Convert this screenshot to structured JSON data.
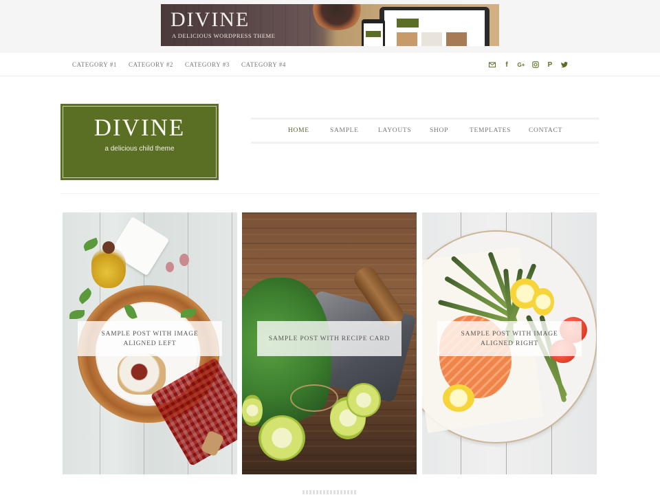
{
  "banner": {
    "title": "DIVINE",
    "tagline": "A DELICIOUS WORDPRESS THEME",
    "preview_logo": "DIVINE"
  },
  "top_nav": {
    "categories": [
      {
        "label": "CATEGORY #1"
      },
      {
        "label": "CATEGORY #2"
      },
      {
        "label": "CATEGORY #3"
      },
      {
        "label": "CATEGORY #4"
      }
    ],
    "social": [
      {
        "name": "email-icon"
      },
      {
        "name": "facebook-icon",
        "glyph": "f"
      },
      {
        "name": "google-plus-icon",
        "glyph": "G+"
      },
      {
        "name": "instagram-icon"
      },
      {
        "name": "pinterest-icon",
        "glyph": "P"
      },
      {
        "name": "twitter-icon"
      }
    ],
    "accent_color": "#5a6e24"
  },
  "header": {
    "site_title": "DIVINE",
    "site_tagline": "a delicious child theme",
    "brand_color": "#5a6e24"
  },
  "main_nav": {
    "items": [
      {
        "label": "HOME",
        "active": true
      },
      {
        "label": "SAMPLE"
      },
      {
        "label": "LAYOUTS"
      },
      {
        "label": "SHOP"
      },
      {
        "label": "TEMPLATES"
      },
      {
        "label": "CONTACT"
      }
    ]
  },
  "posts": [
    {
      "title": "SAMPLE POST WITH IMAGE ALIGNED LEFT"
    },
    {
      "title": "SAMPLE POST WITH RECIPE CARD"
    },
    {
      "title": "SAMPLE POST WITH IMAGE ALIGNED RIGHT"
    }
  ]
}
